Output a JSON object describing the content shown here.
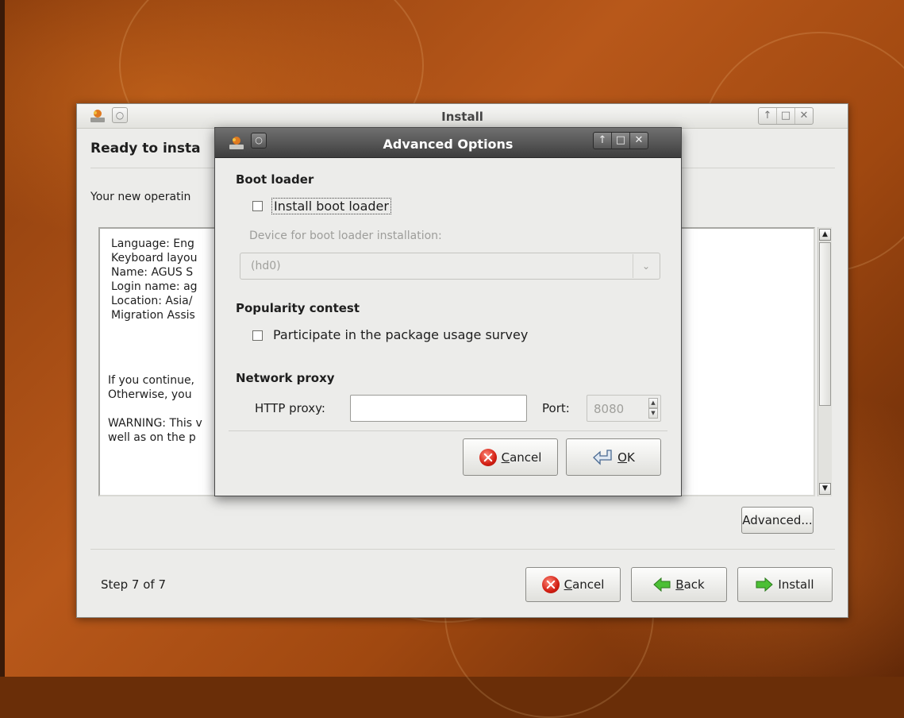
{
  "install_window": {
    "title": "Install",
    "heading": "Ready to insta",
    "intro": "Your new operatin",
    "summary_lines": [
      "Language: Eng",
      "Keyboard layou",
      "Name: AGUS S",
      "Login name: ag",
      "Location: Asia/",
      "Migration Assis"
    ],
    "continue_lines": [
      "If you continue,",
      "Otherwise, you"
    ],
    "warning_lines": [
      "WARNING: This v",
      "well as on the p"
    ],
    "advanced_label": "Advanced...",
    "step": "Step 7 of 7",
    "cancel_prefix": "C",
    "cancel_rest": "ancel",
    "back_prefix": "B",
    "back_rest": "ack",
    "install_label": "Install"
  },
  "advanced_dialog": {
    "title": "Advanced Options",
    "boot_loader": {
      "section": "Boot loader",
      "checkbox_label": "Install boot loader",
      "checked": false,
      "device_label": "Device for boot loader installation:",
      "device_value": "(hd0)"
    },
    "popularity": {
      "section": "Popularity contest",
      "checkbox_label": "Participate in the package usage survey",
      "checked": false
    },
    "network_proxy": {
      "section": "Network proxy",
      "http_label": "HTTP proxy:",
      "http_value": "",
      "port_label": "Port:",
      "port_value": "8080"
    },
    "cancel_prefix": "C",
    "cancel_rest": "ancel",
    "ok_prefix": "O",
    "ok_rest": "K"
  },
  "icons": {
    "cancel": "cancel-icon",
    "back": "back-arrow-icon",
    "install": "forward-arrow-icon",
    "ok": "enter-icon",
    "scroll_up": "scroll-up-icon",
    "scroll_down": "scroll-down-icon"
  },
  "colors": {
    "desktop_accent": "#b8581a",
    "window_bg": "#ececea",
    "dialog_titlebar": "#4a4a4a",
    "cancel_red": "#d21e12",
    "arrow_green": "#3cae2a"
  }
}
